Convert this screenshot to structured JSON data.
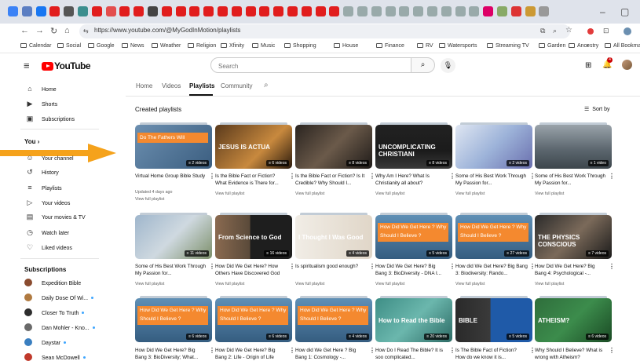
{
  "browser": {
    "url": "https://www.youtube.com/@MyGodInMotion/playlists",
    "bookmarks": [
      "Calendar",
      "Social",
      "Google",
      "News",
      "Weather",
      "Religion",
      "Xfinity",
      "Music",
      "Shopping",
      "House",
      "Finance",
      "RV",
      "Watersports",
      "Streaming TV",
      "Garden",
      "Ancestry",
      "All Bookmarks"
    ],
    "overflow": "»",
    "window_buttons": [
      "–",
      "▢"
    ]
  },
  "header": {
    "logo_text": "YouTube",
    "search_placeholder": "Search"
  },
  "sidebar": {
    "top": [
      {
        "label": "Home",
        "icon": "⌂"
      },
      {
        "label": "Shorts",
        "icon": "▶"
      },
      {
        "label": "Subscriptions",
        "icon": "▣"
      }
    ],
    "you_label": "You",
    "you_items": [
      {
        "label": "Your channel",
        "icon": "☺"
      },
      {
        "label": "History",
        "icon": "↺"
      },
      {
        "label": "Playlists",
        "icon": "≡"
      },
      {
        "label": "Your videos",
        "icon": "▷"
      },
      {
        "label": "Your movies & TV",
        "icon": "▤"
      },
      {
        "label": "Watch later",
        "icon": "◷"
      },
      {
        "label": "Liked videos",
        "icon": "♡"
      }
    ],
    "subs_label": "Subscriptions",
    "subs": [
      {
        "label": "Expedition Bible",
        "color": "#8a4b2f"
      },
      {
        "label": "Daily Dose Of Wi...",
        "color": "#b07a40"
      },
      {
        "label": "Closer To Truth",
        "color": "#2d2d2d"
      },
      {
        "label": "Dan Mohler - Kno...",
        "color": "#6a6a6a"
      },
      {
        "label": "Daystar",
        "color": "#3a7fc0"
      },
      {
        "label": "Sean McDowell",
        "color": "#c0392b"
      }
    ]
  },
  "channel_tabs": [
    "Home",
    "Videos",
    "Playlists",
    "Community"
  ],
  "section_title": "Created playlists",
  "sort_label": "Sort by",
  "playlists": [
    {
      "title": "Virtual Home Group Bible Study",
      "count": "2 videos",
      "meta": "Updated 4 days ago",
      "view": "View full playlist",
      "bg": "linear-gradient(135deg,#6c8fb0,#3b5e80)",
      "overlay": "Do The Fathers Will"
    },
    {
      "title": "Is the Bible Fact or Fiction? What Evidence is There for...",
      "count": "6 videos",
      "meta": "",
      "view": "View full playlist",
      "bg": "linear-gradient(135deg,#5a3a1c,#c8893e 60%,#2a1a0c)",
      "text": "JESUS IS ACTUA"
    },
    {
      "title": "Is the Bible Fact or Fiction? Is It Credible? Why Should I...",
      "count": "8 videos",
      "meta": "",
      "view": "View full playlist",
      "bg": "linear-gradient(135deg,#2a2420,#6b5a4a 50%,#1e1a18)"
    },
    {
      "title": "Why Am I Here? What Is Christianity all about?",
      "count": "8 videos",
      "meta": "",
      "view": "View full playlist",
      "bg": "linear-gradient(180deg,#222 0%,#1b1b1b 60%,#3a3a3a)",
      "text": "UNCOMPLICATING CHRISTIANI"
    },
    {
      "title": "Some of His Best Work Through My Passion for...",
      "count": "2 videos",
      "meta": "",
      "view": "View full playlist",
      "bg": "linear-gradient(135deg,#dfe6f2,#9db3d9 50%,#6a6fae)"
    },
    {
      "title": "Some of His Best Work Through My Passion for...",
      "count": "1 video",
      "meta": "",
      "view": "View full playlist",
      "bg": "linear-gradient(180deg,#9aa3aa,#5d6870 55%,#3d464c)"
    },
    {
      "title": "Some of His Best Work Through My Passion for...",
      "count": "11 videos",
      "meta": "",
      "view": "View full playlist",
      "bg": "linear-gradient(135deg,#9fb6cc,#cfd9e0 50%,#7c8f6a)"
    },
    {
      "title": "How Did We Get Here? How Others Have Discovered God",
      "count": "16 videos",
      "meta": "",
      "view": "View full playlist",
      "bg": "linear-gradient(90deg,#8a6a50 0%,#5a4a3a 45%,#1e1e1e 46%)",
      "text": "From Science to God"
    },
    {
      "title": "Is spiritualism good enough?",
      "count": "4 videos",
      "meta": "",
      "view": "View full playlist",
      "bg": "linear-gradient(90deg,#f1ede6,#e0d6c8)",
      "text": "I Thought I Was Good"
    },
    {
      "title": "How Did We Get Here? Big Bang 3: BioDiversity - DNA I...",
      "count": "5 videos",
      "meta": "",
      "view": "View full playlist",
      "bg": "linear-gradient(180deg,#5f8fb5,#355d80)",
      "overlay": "How Did We Get Here ? Why Should I Believe ?"
    },
    {
      "title": "How did We Get Here? Big Bang 3: Biodiversity: Rando...",
      "count": "27 videos",
      "meta": "",
      "view": "View full playlist",
      "bg": "linear-gradient(180deg,#5f8fb5,#355d80)",
      "overlay": "How Did We Get Here ? Why Should I Believe ?"
    },
    {
      "title": "How Did We Get Here? Big Bang 4: Psychological -...",
      "count": "7 videos",
      "meta": "",
      "view": "View full playlist",
      "bg": "linear-gradient(135deg,#2b2b2b,#7b6a5a 50%,#1a1a1a)",
      "text": "THE PHYSICS CONSCIOUS"
    },
    {
      "title": "How Did We Get Here? Big Bang 3: BioDiversity; What...",
      "count": "6 videos",
      "meta": "",
      "view": "",
      "bg": "linear-gradient(180deg,#5f8fb5,#355d80)",
      "overlay": "How Did We Get Here ? Why Should I Believe ?"
    },
    {
      "title": "How Did We Get Here? Big Bang 2: Life - Origin of Life",
      "count": "6 videos",
      "meta": "",
      "view": "",
      "bg": "linear-gradient(180deg,#5f8fb5,#355d80)",
      "overlay": "How Did We Get Here ? Why Should I Believe ?"
    },
    {
      "title": "How did We Get Here ? Big Bang 1: Cosmology -...",
      "count": "4 videos",
      "meta": "",
      "view": "",
      "bg": "linear-gradient(180deg,#5f8fb5,#355d80)",
      "overlay": "How Did We Get Here ? Why Should I Believe ?"
    },
    {
      "title": "How Do I Read The Bible? It is soo complicated...",
      "count": "20 videos",
      "meta": "",
      "view": "",
      "bg": "linear-gradient(135deg,#3e8e86,#6bb7ad 50%,#2c6a64)",
      "text": "How to Read the Bible"
    },
    {
      "title": "Is The Bible Fact of Fiction? How do we know it is...",
      "count": "5 videos",
      "meta": "",
      "view": "",
      "bg": "linear-gradient(90deg,#2a2a2a 0%,#3a3a3a 45%,#1f5aa8 46%)",
      "text": "BIBLE"
    },
    {
      "title": "Why Should I Believe? What is wrong with Atheism?",
      "count": "6 videos",
      "meta": "",
      "view": "",
      "bg": "linear-gradient(135deg,#2f6e3c,#3c8c4c 50%,#1a4a24)",
      "text": "ATHEISM?"
    }
  ]
}
